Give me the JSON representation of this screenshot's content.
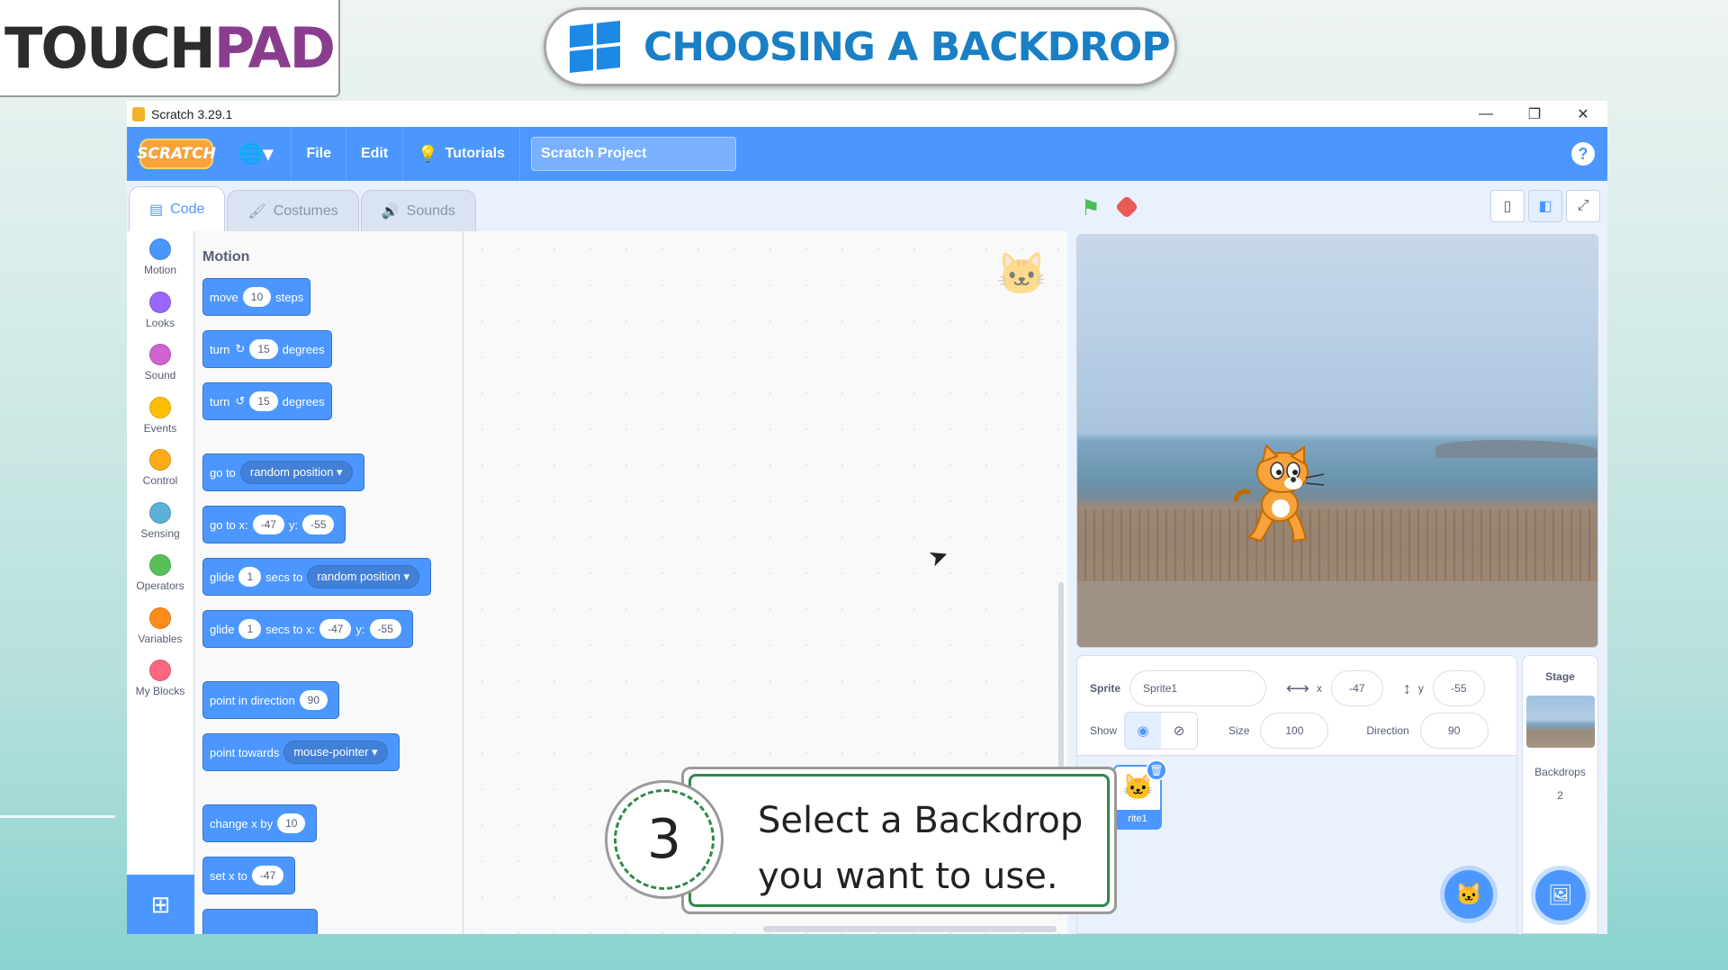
{
  "banner": {
    "logo_part1": "TOUCH",
    "logo_part2": "PAD",
    "title": "CHOOSING A BACKDROP"
  },
  "window": {
    "title": "Scratch 3.29.1",
    "minimize": "—",
    "restore": "❐",
    "close": "✕"
  },
  "menubar": {
    "logo": "SCRATCH",
    "globe": "🌐▾",
    "file": "File",
    "edit": "Edit",
    "tutorials": "Tutorials",
    "project_title": "Scratch Project",
    "help": "?"
  },
  "tabs": {
    "code": "Code",
    "costumes": "Costumes",
    "sounds": "Sounds"
  },
  "categories": [
    {
      "label": "Motion",
      "color": "#4c97ff"
    },
    {
      "label": "Looks",
      "color": "#9966ff"
    },
    {
      "label": "Sound",
      "color": "#cf63cf"
    },
    {
      "label": "Events",
      "color": "#ffbf00"
    },
    {
      "label": "Control",
      "color": "#ffab19"
    },
    {
      "label": "Sensing",
      "color": "#5cb1d6"
    },
    {
      "label": "Operators",
      "color": "#59c059"
    },
    {
      "label": "Variables",
      "color": "#ff8c1a"
    },
    {
      "label": "My Blocks",
      "color": "#ff6680"
    }
  ],
  "palette": {
    "section": "Motion",
    "blocks": {
      "move": {
        "a": "move",
        "v": "10",
        "b": "steps"
      },
      "turn_right": {
        "a": "turn",
        "icon": "↻",
        "v": "15",
        "b": "degrees"
      },
      "turn_left": {
        "a": "turn",
        "icon": "↺",
        "v": "15",
        "b": "degrees"
      },
      "goto": {
        "a": "go to",
        "dd": "random position ▾"
      },
      "goto_xy": {
        "a": "go to x:",
        "x": "-47",
        "b": "y:",
        "y": "-55"
      },
      "glide_to": {
        "a": "glide",
        "v": "1",
        "b": "secs to",
        "dd": "random position ▾"
      },
      "glide_xy": {
        "a": "glide",
        "v": "1",
        "b": "secs to x:",
        "x": "-47",
        "c": "y:",
        "y": "-55"
      },
      "point_dir": {
        "a": "point in direction",
        "v": "90"
      },
      "point_towards": {
        "a": "point towards",
        "dd": "mouse-pointer ▾"
      },
      "change_x": {
        "a": "change x by",
        "v": "10"
      },
      "set_x": {
        "a": "set x to",
        "v": "-47"
      }
    }
  },
  "sprite_info": {
    "sprite_label": "Sprite",
    "sprite_name": "Sprite1",
    "x_label": "x",
    "x_value": "-47",
    "y_label": "y",
    "y_value": "-55",
    "show_label": "Show",
    "size_label": "Size",
    "size_value": "100",
    "direction_label": "Direction",
    "direction_value": "90"
  },
  "sprite_list": {
    "thumb_name": "rite1"
  },
  "stage_panel": {
    "label": "Stage",
    "backdrops_label": "Backdrops",
    "backdrops_count": "2"
  },
  "callout": {
    "step": "3",
    "line1": "Select a Backdrop",
    "line2": "you want to use."
  }
}
